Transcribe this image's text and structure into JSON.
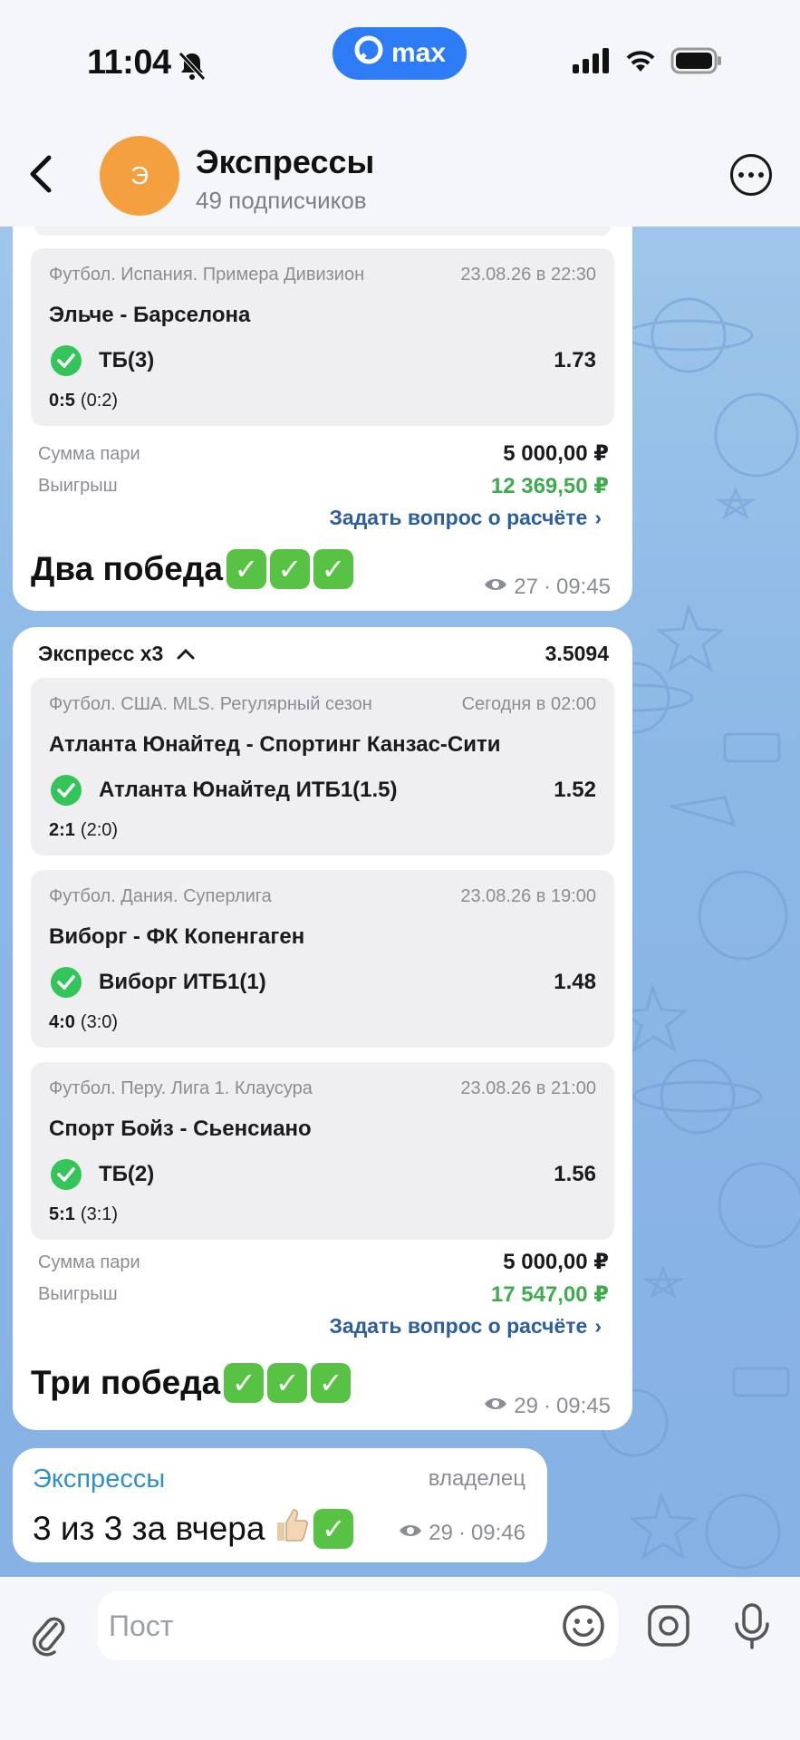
{
  "status": {
    "time": "11:04",
    "app_badge": "max"
  },
  "header": {
    "title": "Экспрессы",
    "avatar_letter": "Э",
    "subtitle": "49 подписчиков"
  },
  "messages": [
    {
      "bets": [
        {
          "league": "Футбол. Испания. Примера Дивизион",
          "date": "23.08.26 в 22:30",
          "match": "Эльче - Барселона",
          "pick": "ТБ(3)",
          "odds": "1.73",
          "score": "0:5",
          "half": "(0:2)"
        }
      ],
      "stake_label": "Сумма пари",
      "stake": "5 000,00 ₽",
      "win_label": "Выигрыш",
      "win": "12 369,50 ₽",
      "ask": "Задать вопрос о расчёте",
      "caption": "Два победа",
      "views": "27",
      "time": "09:45"
    },
    {
      "title": "Экспресс x3",
      "total_odds": "3.5094",
      "bets": [
        {
          "league": "Футбол. США. MLS. Регулярный сезон",
          "date": "Сегодня в 02:00",
          "match": "Атланта Юнайтед - Спортинг Канзас-Сити",
          "pick": "Атланта Юнайтед ИТБ1(1.5)",
          "odds": "1.52",
          "score": "2:1",
          "half": "(2:0)"
        },
        {
          "league": "Футбол. Дания. Суперлига",
          "date": "23.08.26 в 19:00",
          "match": "Виборг - ФК Копенгаген",
          "pick": "Виборг ИТБ1(1)",
          "odds": "1.48",
          "score": "4:0",
          "half": "(3:0)"
        },
        {
          "league": "Футбол. Перу. Лига 1. Клаусура",
          "date": "23.08.26 в 21:00",
          "match": "Спорт Бойз - Сьенсиано",
          "pick": "ТБ(2)",
          "odds": "1.56",
          "score": "5:1",
          "half": "(3:1)"
        }
      ],
      "stake_label": "Сумма пари",
      "stake": "5 000,00 ₽",
      "win_label": "Выигрыш",
      "win": "17 547,00 ₽",
      "ask": "Задать вопрос о расчёте",
      "caption": "Три победа",
      "views": "29",
      "time": "09:45"
    },
    {
      "author": "Экспрессы",
      "role": "владелец",
      "text": "3 из 3 за вчера",
      "views": "29",
      "time": "09:46"
    }
  ],
  "composer": {
    "placeholder": "Пост"
  },
  "colors": {
    "accent": "#2d7cf6",
    "win_green": "#3fab4f",
    "link": "#2c5ea0",
    "check": "#34c55a"
  }
}
